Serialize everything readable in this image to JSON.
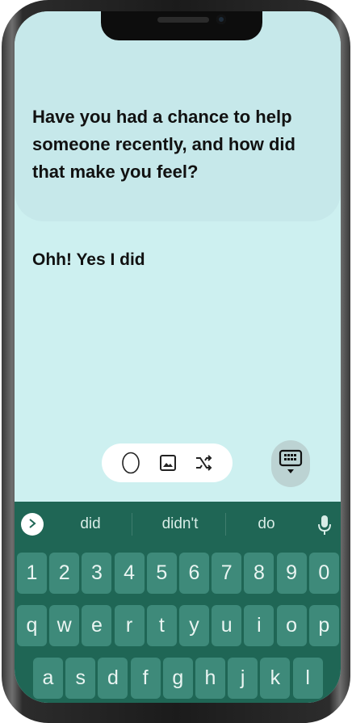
{
  "question": {
    "text": "Have you had a chance to help someone recently, and how did that make you feel?"
  },
  "answer": {
    "text": "Ohh! Yes I did"
  },
  "toolbar": {
    "icons": [
      "circle-icon",
      "image-icon",
      "shuffle-icon"
    ],
    "keyboard_toggle_icon": "keyboard-hide-icon"
  },
  "keyboard": {
    "suggestions": [
      "did",
      "didn't",
      "do"
    ],
    "row_numbers": [
      "1",
      "2",
      "3",
      "4",
      "5",
      "6",
      "7",
      "8",
      "9",
      "0"
    ],
    "row_top": [
      "q",
      "w",
      "e",
      "r",
      "t",
      "y",
      "u",
      "i",
      "o",
      "p"
    ],
    "row_middle": [
      "a",
      "s",
      "d",
      "f",
      "g",
      "h",
      "j",
      "k",
      "l"
    ],
    "colors": {
      "background": "#1f6655",
      "key": "#3e8a7a",
      "screen": "#cdf0f0",
      "card": "#c6e8ea"
    }
  }
}
